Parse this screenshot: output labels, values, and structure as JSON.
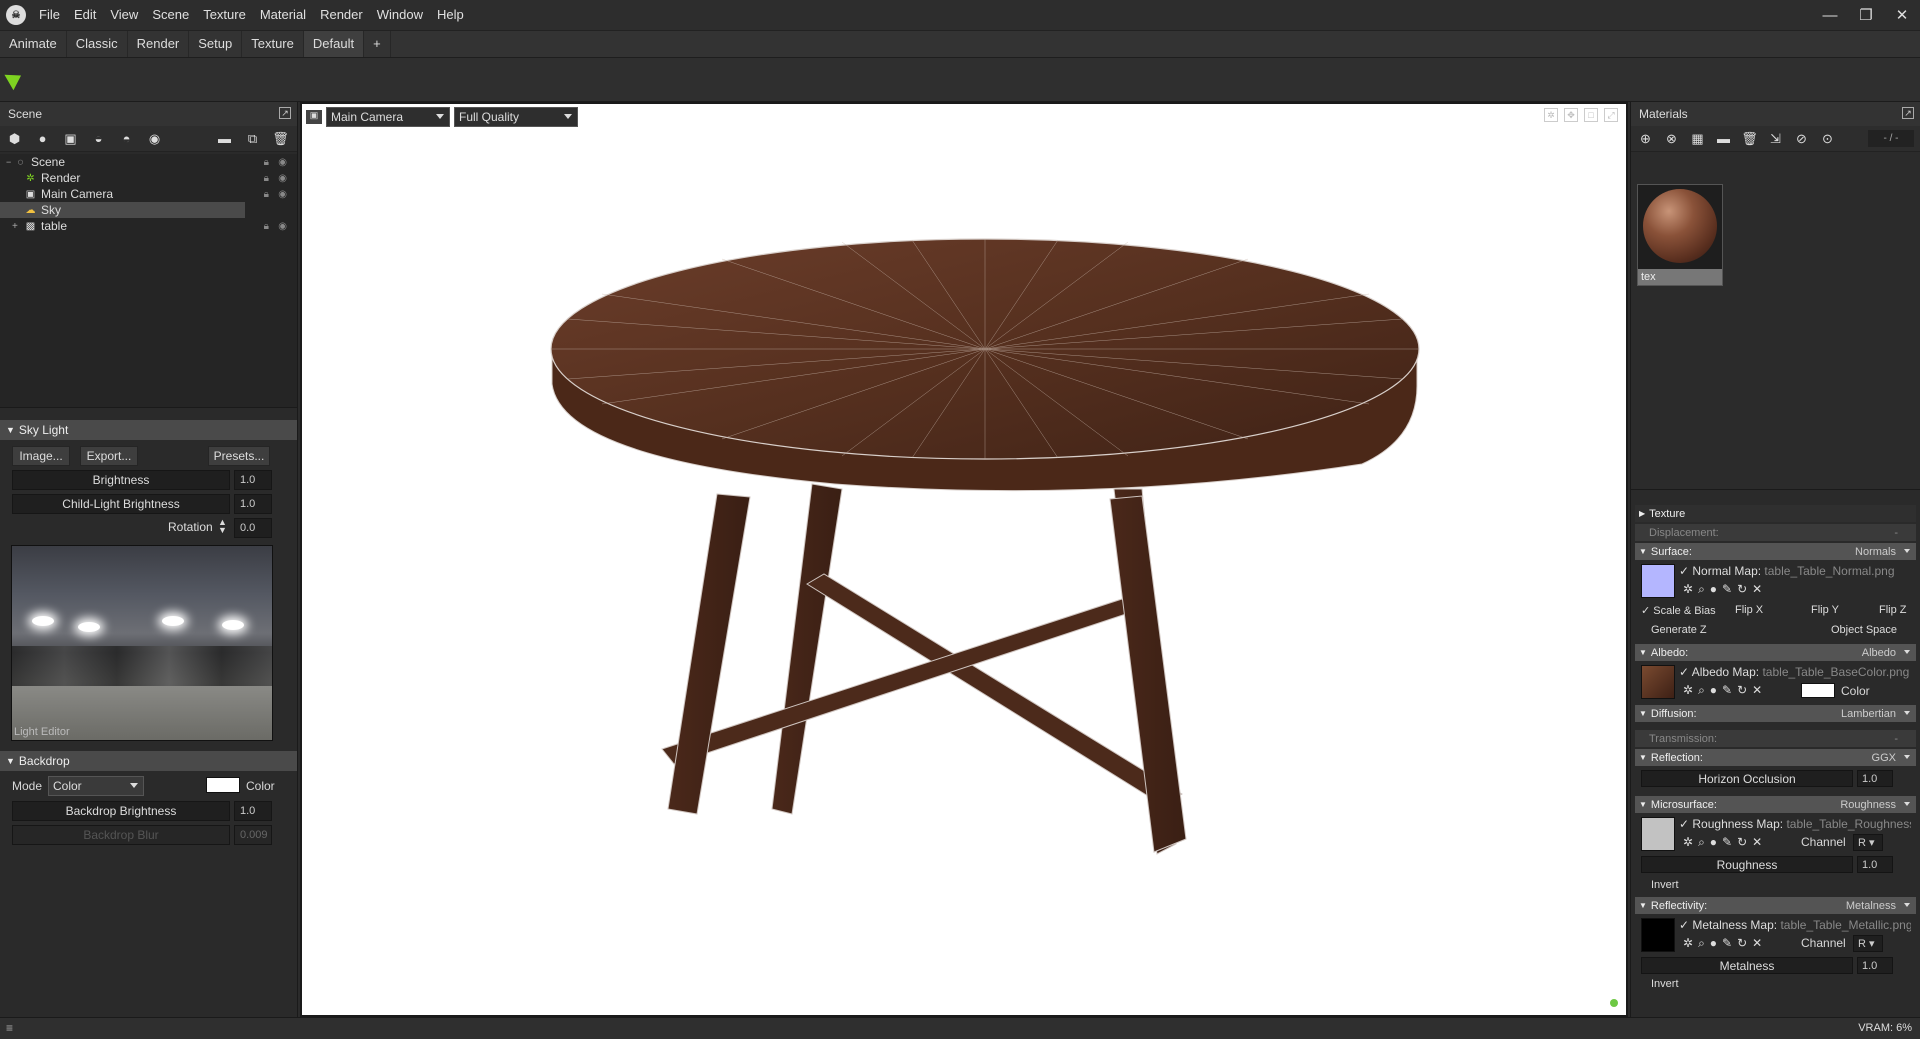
{
  "menubar": {
    "items": [
      "File",
      "Edit",
      "View",
      "Scene",
      "Texture",
      "Material",
      "Render",
      "Window",
      "Help"
    ],
    "window_controls": {
      "minimize": "—",
      "restore": "❐",
      "close": "✕"
    }
  },
  "workspace_tabs": [
    "Animate",
    "Classic",
    "Render",
    "Setup",
    "Texture",
    "Default",
    "+"
  ],
  "active_tab": "Default",
  "scene_panel": {
    "title": "Scene",
    "tree": [
      {
        "label": "Scene",
        "icon": "scene-icon"
      },
      {
        "label": "Render",
        "icon": "render-gear-icon"
      },
      {
        "label": "Main Camera",
        "icon": "camera-icon"
      },
      {
        "label": "Sky",
        "icon": "sky-icon",
        "selected": true
      },
      {
        "label": "table",
        "icon": "mesh-icon"
      }
    ]
  },
  "sky_light": {
    "title": "Sky Light",
    "buttons": {
      "image": "Image...",
      "export": "Export...",
      "presets": "Presets..."
    },
    "brightness_label": "Brightness",
    "brightness_value": "1.0",
    "child_brightness_label": "Child-Light Brightness",
    "child_brightness_value": "1.0",
    "rotation_label": "Rotation",
    "rotation_value": "0.0",
    "editor_label": "Light Editor"
  },
  "backdrop": {
    "title": "Backdrop",
    "mode_label": "Mode",
    "mode_value": "Color",
    "color_label": "Color",
    "brightness_label": "Backdrop Brightness",
    "brightness_value": "1.0",
    "blur_label": "Backdrop Blur",
    "blur_value": "0.009"
  },
  "viewport": {
    "camera": "Main Camera",
    "quality": "Full Quality"
  },
  "materials_panel": {
    "title": "Materials",
    "counter": "- / -",
    "material_name": "tex",
    "texture_label": "Texture",
    "displacement": {
      "label": "Displacement:",
      "value": "-"
    },
    "surface": {
      "label": "Surface:",
      "value": "Normals"
    },
    "normal_map": {
      "label": "Normal Map:",
      "file": "table_Table_Normal.png"
    },
    "scale_bias": "Scale & Bias",
    "flip_x": "Flip X",
    "flip_y": "Flip Y",
    "flip_z": "Flip Z",
    "generate_z": "Generate Z",
    "object_space": "Object Space",
    "albedo": {
      "label": "Albedo:",
      "value": "Albedo"
    },
    "albedo_map": {
      "label": "Albedo Map:",
      "file": "table_Table_BaseColor.png"
    },
    "albedo_color_label": "Color",
    "diffusion": {
      "label": "Diffusion:",
      "value": "Lambertian"
    },
    "transmission": {
      "label": "Transmission:",
      "value": "-"
    },
    "reflection": {
      "label": "Reflection:",
      "value": "GGX"
    },
    "horizon_occlusion": {
      "label": "Horizon Occlusion",
      "value": "1.0"
    },
    "microsurface": {
      "label": "Microsurface:",
      "value": "Roughness"
    },
    "roughness_map": {
      "label": "Roughness Map:",
      "file": "table_Table_Roughness.png",
      "channel_label": "Channel",
      "channel": "R"
    },
    "roughness": {
      "label": "Roughness",
      "value": "1.0"
    },
    "invert": "Invert",
    "reflectivity": {
      "label": "Reflectivity:",
      "value": "Metalness"
    },
    "metalness_map": {
      "label": "Metalness Map:",
      "file": "table_Table_Metallic.png",
      "channel_label": "Channel",
      "channel": "R"
    },
    "metalness": {
      "label": "Metalness",
      "value": "1.0"
    },
    "invert2": "Invert"
  },
  "statusbar": {
    "vram": "VRAM: 6%"
  },
  "colors": {
    "accent_green": "#7ed321",
    "wood": "#5a3222",
    "panel": "#2a2a2a"
  }
}
